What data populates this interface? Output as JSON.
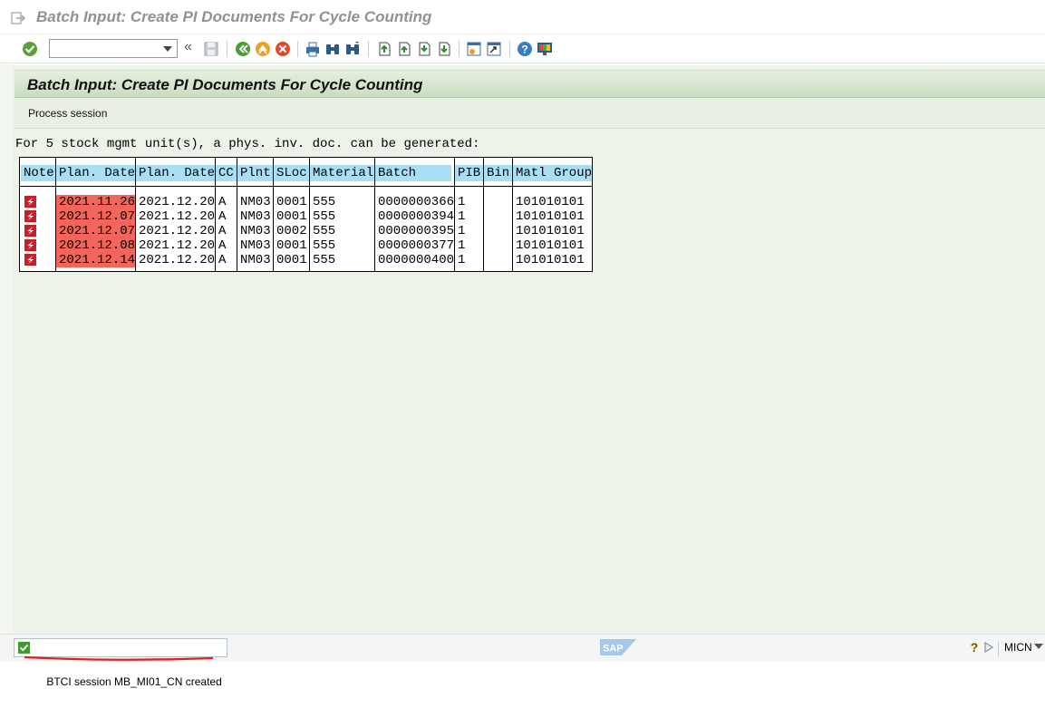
{
  "window": {
    "title": "Batch Input: Create PI Documents For Cycle Counting"
  },
  "toolbar": {
    "command_field_value": "",
    "back_chevron": "«",
    "icons": [
      "enter-icon",
      "save-icon",
      "back-icon",
      "exit-icon",
      "cancel-icon",
      "print-icon",
      "find-icon",
      "find-next-icon",
      "first-page-icon",
      "previous-page-icon",
      "next-page-icon",
      "last-page-icon",
      "create-session-icon",
      "generate-shortcut-icon",
      "help-icon",
      "customize-layout-icon"
    ]
  },
  "header": {
    "title": "Batch Input: Create PI Documents For Cycle Counting"
  },
  "appbar": {
    "process_session_label": "Process session"
  },
  "list": {
    "info_line": "For 5 stock mgmt unit(s), a phys. inv. doc. can be generated:",
    "columns": [
      "Note",
      "Plan. Date",
      "Plan. Date",
      "CC",
      "Plnt",
      "SLoc",
      "Material",
      "Batch",
      "PIB",
      "Bin",
      "Matl Group"
    ],
    "rows": [
      {
        "note_icon": "late-icon",
        "plan_date_1": "2021.11.26",
        "plan_date_2": "2021.12.20",
        "cc": "A",
        "plnt": "NM03",
        "sloc": "0001",
        "material": "555",
        "batch": "0000000366",
        "pib": "1",
        "bin": "",
        "matl_group": "101010101"
      },
      {
        "note_icon": "late-icon",
        "plan_date_1": "2021.12.07",
        "plan_date_2": "2021.12.20",
        "cc": "A",
        "plnt": "NM03",
        "sloc": "0001",
        "material": "555",
        "batch": "0000000394",
        "pib": "1",
        "bin": "",
        "matl_group": "101010101"
      },
      {
        "note_icon": "late-icon",
        "plan_date_1": "2021.12.07",
        "plan_date_2": "2021.12.20",
        "cc": "A",
        "plnt": "NM03",
        "sloc": "0002",
        "material": "555",
        "batch": "0000000395",
        "pib": "1",
        "bin": "",
        "matl_group": "101010101"
      },
      {
        "note_icon": "late-icon",
        "plan_date_1": "2021.12.08",
        "plan_date_2": "2021.12.20",
        "cc": "A",
        "plnt": "NM03",
        "sloc": "0001",
        "material": "555",
        "batch": "0000000377",
        "pib": "1",
        "bin": "",
        "matl_group": "101010101"
      },
      {
        "note_icon": "late-icon",
        "plan_date_1": "2021.12.14",
        "plan_date_2": "2021.12.20",
        "cc": "A",
        "plnt": "NM03",
        "sloc": "0001",
        "material": "555",
        "batch": "0000000400",
        "pib": "1",
        "bin": "",
        "matl_group": "101010101"
      }
    ]
  },
  "status": {
    "message": "BTCI session MB_MI01_CN created",
    "system": "MICN"
  },
  "colors": {
    "overdue_highlight": "#f2655a",
    "header_cell": "#a9dff5",
    "work_area": "#eef3ea",
    "underline_annotation": "#e0201e"
  }
}
